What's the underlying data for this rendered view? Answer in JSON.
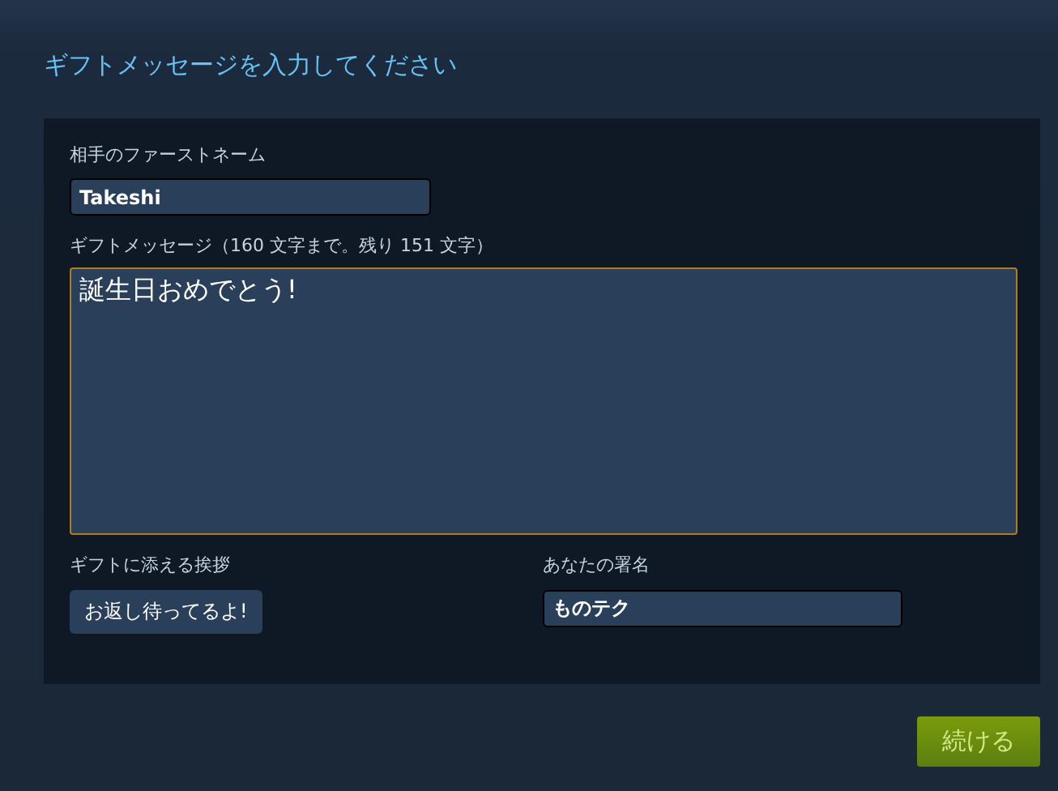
{
  "title": "ギフトメッセージを入力してください",
  "recipient": {
    "label": "相手のファーストネーム",
    "value": "Takeshi"
  },
  "message": {
    "label": "ギフトメッセージ（160 文字まで。残り 151 文字）",
    "value": "誕生日おめでとう!",
    "focused": true
  },
  "greeting": {
    "label": "ギフトに添える挨拶",
    "button": "お返し待ってるよ!"
  },
  "signature": {
    "label": "あなたの署名",
    "value": "ものテク"
  },
  "continue_button": "続ける"
}
